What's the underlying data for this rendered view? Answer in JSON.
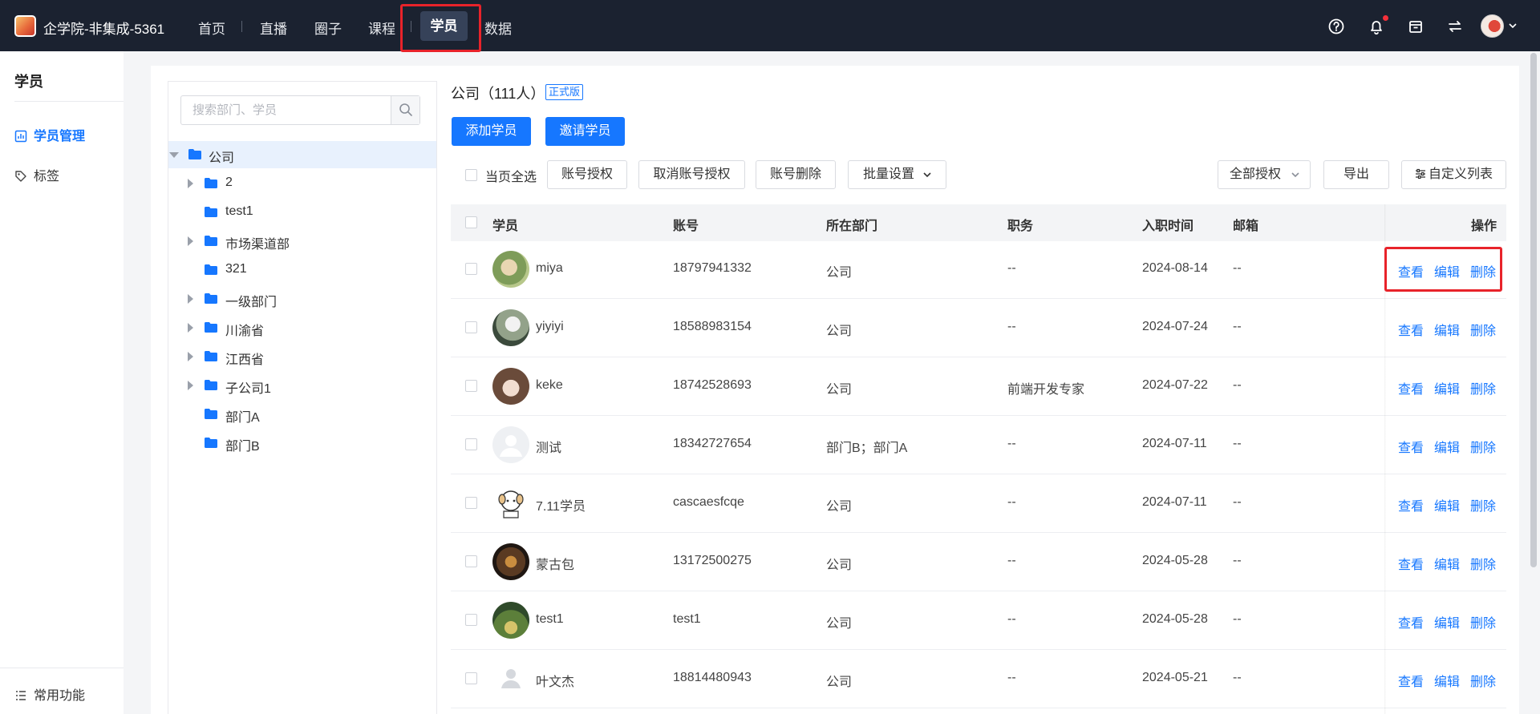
{
  "app": {
    "title": "企学院-非集成-5361"
  },
  "nav": {
    "items": [
      "首页",
      "直播",
      "圈子",
      "课程",
      "学员",
      "数据"
    ],
    "active": "学员"
  },
  "sidebar": {
    "title": "学员",
    "items": [
      {
        "label": "学员管理",
        "icon": "chart-icon",
        "active": true
      },
      {
        "label": "标签",
        "icon": "tag-icon",
        "active": false
      }
    ],
    "bottom": {
      "label": "常用功能",
      "icon": "list-icon"
    }
  },
  "search": {
    "placeholder": "搜索部门、学员",
    "value": ""
  },
  "tree": {
    "root": "公司",
    "children": [
      {
        "label": "2",
        "expandable": true
      },
      {
        "label": "test1",
        "expandable": false
      },
      {
        "label": "市场渠道部",
        "expandable": true
      },
      {
        "label": "321",
        "expandable": false
      },
      {
        "label": "一级部门",
        "expandable": true
      },
      {
        "label": "川渝省",
        "expandable": true
      },
      {
        "label": "江西省",
        "expandable": true
      },
      {
        "label": "子公司1",
        "expandable": true
      },
      {
        "label": "部门A",
        "expandable": false
      },
      {
        "label": "部门B",
        "expandable": false
      }
    ]
  },
  "content": {
    "company_title": "公司（111人）",
    "badge": "正式版",
    "add_button": "添加学员",
    "invite_button": "邀请学员",
    "select_all": "当页全选",
    "toolbar": {
      "authorize": "账号授权",
      "cancel_authorize": "取消账号授权",
      "delete": "账号删除",
      "batch": "批量设置",
      "all_auth": "全部授权",
      "export": "导出",
      "custom_columns": "自定义列表"
    }
  },
  "table": {
    "columns": [
      "学员",
      "账号",
      "所在部门",
      "职务",
      "入职时间",
      "邮箱",
      "操作"
    ],
    "actions": [
      "查看",
      "编辑",
      "删除"
    ],
    "rows": [
      {
        "name": "miya",
        "account": "18797941332",
        "dept": "公司",
        "title": "--",
        "date": "2024-08-14",
        "email": "--"
      },
      {
        "name": "yiyiyi",
        "account": "18588983154",
        "dept": "公司",
        "title": "--",
        "date": "2024-07-24",
        "email": "--"
      },
      {
        "name": "keke",
        "account": "18742528693",
        "dept": "公司",
        "title": "前端开发专家",
        "date": "2024-07-22",
        "email": "--"
      },
      {
        "name": "测试",
        "account": "18342727654",
        "dept": "部门B；部门A",
        "title": "--",
        "date": "2024-07-11",
        "email": "--"
      },
      {
        "name": "7.11学员",
        "account": "cascaesfcqe",
        "dept": "公司",
        "title": "--",
        "date": "2024-07-11",
        "email": "--"
      },
      {
        "name": "蒙古包",
        "account": "13172500275",
        "dept": "公司",
        "title": "--",
        "date": "2024-05-28",
        "email": "--"
      },
      {
        "name": "test1",
        "account": "test1",
        "dept": "公司",
        "title": "--",
        "date": "2024-05-28",
        "email": "--"
      },
      {
        "name": "叶文杰",
        "account": "18814480943",
        "dept": "公司",
        "title": "--",
        "date": "2024-05-21",
        "email": "--"
      }
    ]
  },
  "colors": {
    "topbar": "#1b2230",
    "accent": "#1677ff",
    "highlight": "#e8232a"
  }
}
